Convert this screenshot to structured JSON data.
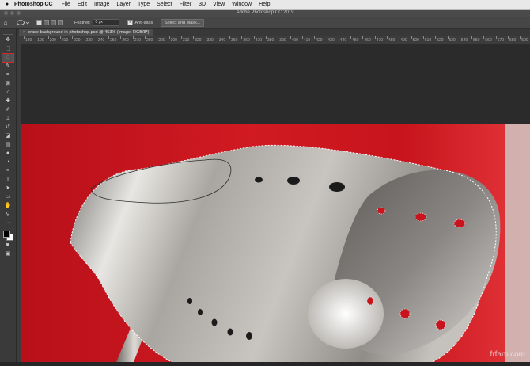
{
  "menubar": {
    "apple_icon": "apple-icon",
    "app_name": "Photoshop CC",
    "items": [
      "File",
      "Edit",
      "Image",
      "Layer",
      "Type",
      "Select",
      "Filter",
      "3D",
      "View",
      "Window",
      "Help"
    ]
  },
  "titlebar": {
    "title": "Adobe Photoshop CC 2019"
  },
  "options": {
    "feather_label": "Feather:",
    "feather_value": "0 px",
    "anti_alias_label": "Anti-alias",
    "anti_alias_checked": true,
    "select_mask_label": "Select and Mask..."
  },
  "document": {
    "tab_label": "erase-background-in-photoshop.psd @ 453% (Image, RGB/8*)",
    "close_glyph": "×",
    "modified_marker": "*"
  },
  "ruler": {
    "labels": [
      "180",
      "190",
      "200",
      "210",
      "220",
      "230",
      "240",
      "250",
      "260",
      "270",
      "280",
      "290",
      "300",
      "310",
      "320",
      "330",
      "340",
      "350",
      "360",
      "370",
      "380",
      "390",
      "400",
      "410",
      "420",
      "430",
      "440",
      "450",
      "460",
      "470",
      "480",
      "490",
      "500",
      "510",
      "520",
      "530",
      "540",
      "550",
      "560",
      "570",
      "580",
      "590"
    ]
  },
  "tools": [
    {
      "name": "move-tool-icon",
      "glyph": "✥"
    },
    {
      "name": "marquee-tool-icon",
      "glyph": "⬚"
    },
    {
      "name": "lasso-tool-icon",
      "glyph": "◌",
      "selected": true
    },
    {
      "name": "quick-selection-tool-icon",
      "glyph": "✎"
    },
    {
      "name": "crop-tool-icon",
      "glyph": "⌗"
    },
    {
      "name": "frame-tool-icon",
      "glyph": "⊠"
    },
    {
      "name": "eyedropper-tool-icon",
      "glyph": "⁄"
    },
    {
      "name": "healing-brush-tool-icon",
      "glyph": "✚"
    },
    {
      "name": "brush-tool-icon",
      "glyph": "✐"
    },
    {
      "name": "clone-stamp-tool-icon",
      "glyph": "⊥"
    },
    {
      "name": "history-brush-tool-icon",
      "glyph": "↺"
    },
    {
      "name": "eraser-tool-icon",
      "glyph": "◪"
    },
    {
      "name": "gradient-tool-icon",
      "glyph": "▤"
    },
    {
      "name": "blur-tool-icon",
      "glyph": "●"
    },
    {
      "name": "dodge-tool-icon",
      "glyph": "◔"
    },
    {
      "name": "pen-tool-icon",
      "glyph": "✒"
    },
    {
      "name": "type-tool-icon",
      "glyph": "T"
    },
    {
      "name": "path-selection-tool-icon",
      "glyph": "➤"
    },
    {
      "name": "rectangle-tool-icon",
      "glyph": "▭"
    },
    {
      "name": "hand-tool-icon",
      "glyph": "✋"
    },
    {
      "name": "zoom-tool-icon",
      "glyph": "⚲"
    },
    {
      "name": "edit-toolbar-icon",
      "glyph": "···"
    }
  ],
  "bottom_tools": [
    {
      "name": "quick-mask-icon",
      "glyph": "◙"
    },
    {
      "name": "screen-mode-icon",
      "glyph": "▣"
    }
  ],
  "colors": {
    "red_background": "#c8141c",
    "selection_color": "#ffffff",
    "lamp_metal": "#b3b0ab"
  },
  "watermark": "frfam.com"
}
